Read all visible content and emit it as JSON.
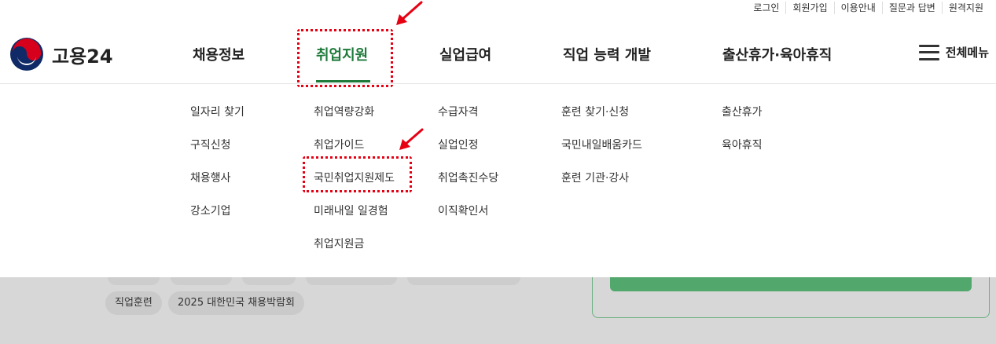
{
  "util_links": [
    "로그인",
    "회원가입",
    "이용안내",
    "질문과 답변",
    "원격지원"
  ],
  "logo": {
    "text": "고용24"
  },
  "gnb": [
    "채용정보",
    "취업지원",
    "실업급여",
    "직업 능력 개발",
    "출산휴가·육아휴직"
  ],
  "all_menu_label": "전체메뉴",
  "submenus": {
    "col1": [
      "일자리 찾기",
      "구직신청",
      "채용행사",
      "강소기업"
    ],
    "col2": [
      "취업역량강화",
      "취업가이드",
      "국민취업지원제도",
      "미래내일 일경험",
      "취업지원금"
    ],
    "col3": [
      "수급자격",
      "실업인정",
      "취업촉진수당",
      "이직확인서"
    ],
    "col4": [
      "훈련 찾기·신청",
      "국민내일배움카드",
      "훈련 기관·강사"
    ],
    "col5": [
      "출산휴가",
      "육아휴직"
    ]
  },
  "chips": [
    "직업훈련",
    "2025 대한민국 채용박람회"
  ],
  "colors": {
    "accent_green": "#1e7a3a",
    "annotation_red": "#e60012"
  }
}
